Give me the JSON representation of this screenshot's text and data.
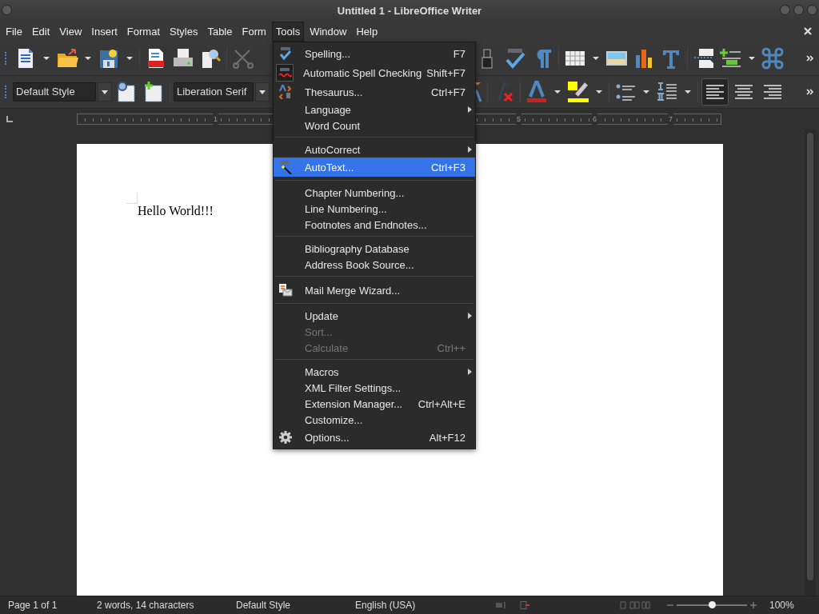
{
  "window": {
    "title": "Untitled 1 - LibreOffice Writer"
  },
  "menubar": [
    {
      "label": "File",
      "selected": false
    },
    {
      "label": "Edit",
      "selected": false
    },
    {
      "label": "View",
      "selected": false
    },
    {
      "label": "Insert",
      "selected": false
    },
    {
      "label": "Format",
      "selected": false
    },
    {
      "label": "Styles",
      "selected": false
    },
    {
      "label": "Table",
      "selected": false
    },
    {
      "label": "Form",
      "selected": false
    },
    {
      "label": "Tools",
      "selected": true
    },
    {
      "label": "Window",
      "selected": false
    },
    {
      "label": "Help",
      "selected": false
    }
  ],
  "formatting_toolbar": {
    "paragraph_style": "Default Style",
    "font_name": "Liberation Serif",
    "alignment": [
      {
        "selected": true
      },
      {
        "selected": false
      },
      {
        "selected": false
      }
    ]
  },
  "ruler": {
    "numbers": [
      "1",
      "5",
      "6",
      "7"
    ]
  },
  "document": {
    "text": "Hello World!!!"
  },
  "tools_menu": [
    {
      "kind": "item",
      "label": "Spelling...",
      "shortcut": "F7",
      "submenu": false,
      "disabled": false,
      "selected": false,
      "checked": false
    },
    {
      "kind": "item",
      "label": "Automatic Spell Checking",
      "shortcut": "Shift+F7",
      "submenu": false,
      "disabled": false,
      "selected": false,
      "checked": true
    },
    {
      "kind": "item",
      "label": "Thesaurus...",
      "shortcut": "Ctrl+F7",
      "submenu": false,
      "disabled": false,
      "selected": false,
      "checked": false
    },
    {
      "kind": "item",
      "label": "Language",
      "submenu": true,
      "disabled": false,
      "selected": false,
      "checked": false
    },
    {
      "kind": "item",
      "label": "Word Count",
      "submenu": false,
      "disabled": false,
      "selected": false,
      "checked": false
    },
    {
      "kind": "separator"
    },
    {
      "kind": "item",
      "label": "AutoCorrect",
      "submenu": true,
      "disabled": false,
      "selected": false,
      "checked": false
    },
    {
      "kind": "item",
      "label": "AutoText...",
      "shortcut": "Ctrl+F3",
      "submenu": false,
      "disabled": false,
      "selected": true,
      "checked": false
    },
    {
      "kind": "separator"
    },
    {
      "kind": "item",
      "label": "Chapter Numbering...",
      "submenu": false,
      "disabled": false,
      "selected": false,
      "checked": false
    },
    {
      "kind": "item",
      "label": "Line Numbering...",
      "submenu": false,
      "disabled": false,
      "selected": false,
      "checked": false
    },
    {
      "kind": "item",
      "label": "Footnotes and Endnotes...",
      "submenu": false,
      "disabled": false,
      "selected": false,
      "checked": false
    },
    {
      "kind": "separator"
    },
    {
      "kind": "item",
      "label": "Bibliography Database",
      "submenu": false,
      "disabled": false,
      "selected": false,
      "checked": false
    },
    {
      "kind": "item",
      "label": "Address Book Source...",
      "submenu": false,
      "disabled": false,
      "selected": false,
      "checked": false
    },
    {
      "kind": "separator"
    },
    {
      "kind": "item",
      "label": "Mail Merge Wizard...",
      "submenu": false,
      "disabled": false,
      "selected": false,
      "checked": false
    },
    {
      "kind": "separator"
    },
    {
      "kind": "item",
      "label": "Update",
      "submenu": true,
      "disabled": false,
      "selected": false,
      "checked": false
    },
    {
      "kind": "item",
      "label": "Sort...",
      "submenu": false,
      "disabled": true,
      "selected": false,
      "checked": false
    },
    {
      "kind": "item",
      "label": "Calculate",
      "shortcut": "Ctrl++",
      "submenu": false,
      "disabled": true,
      "selected": false,
      "checked": false
    },
    {
      "kind": "separator"
    },
    {
      "kind": "item",
      "label": "Macros",
      "submenu": true,
      "disabled": false,
      "selected": false,
      "checked": false
    },
    {
      "kind": "item",
      "label": "XML Filter Settings...",
      "submenu": false,
      "disabled": false,
      "selected": false,
      "checked": false
    },
    {
      "kind": "item",
      "label": "Extension Manager...",
      "shortcut": "Ctrl+Alt+E",
      "submenu": false,
      "disabled": false,
      "selected": false,
      "checked": false
    },
    {
      "kind": "item",
      "label": "Customize...",
      "submenu": false,
      "disabled": false,
      "selected": false,
      "checked": false
    },
    {
      "kind": "item",
      "label": "Options...",
      "shortcut": "Alt+F12",
      "submenu": false,
      "disabled": false,
      "selected": false,
      "checked": false
    }
  ],
  "status_bar": {
    "page": "Page 1 of 1",
    "word_count": "2 words, 14 characters",
    "page_style": "Default Style",
    "language": "English (USA)",
    "zoom": {
      "level": 0.5,
      "reading": "100%"
    }
  }
}
